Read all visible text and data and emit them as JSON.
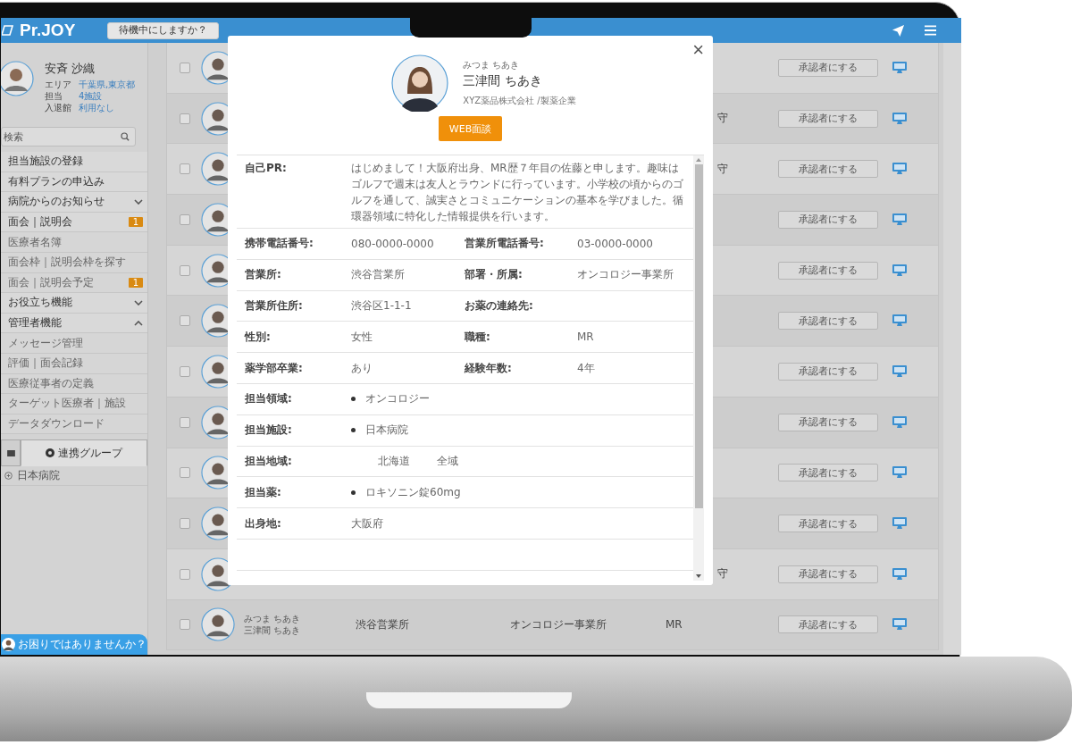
{
  "top_bar": {
    "logo": "Pr.JOY",
    "status_button": "待機中にしますか？"
  },
  "sidebar": {
    "profile": {
      "name": "安斉 沙織",
      "fields": [
        {
          "label": "エリア",
          "value": "千葉県,東京都"
        },
        {
          "label": "担当",
          "value": "4施設"
        },
        {
          "label": "入退館",
          "value": "利用なし"
        }
      ]
    },
    "search": {
      "placeholder": "検索"
    },
    "menu": [
      {
        "kind": "link",
        "label": "担当施設の登録"
      },
      {
        "kind": "link",
        "label": "有料プランの申込み"
      },
      {
        "kind": "group",
        "label": "病院からのお知らせ",
        "expanded": false
      },
      {
        "kind": "section",
        "label": "面会｜説明会",
        "badge": "1",
        "children": [
          {
            "label": "医療者名簿"
          },
          {
            "label": "面会枠｜説明会枠を探す"
          },
          {
            "label": "面会｜説明会予定",
            "badge": "1"
          }
        ]
      },
      {
        "kind": "group",
        "label": "お役立ち機能",
        "expanded": false
      },
      {
        "kind": "group",
        "label": "管理者機能",
        "expanded": true,
        "children": [
          {
            "label": "メッセージ管理"
          },
          {
            "label": "評価｜面会記録"
          },
          {
            "label": "医療従事者の定義"
          },
          {
            "label": "ターゲット医療者｜施設"
          },
          {
            "label": "データダウンロード"
          }
        ]
      }
    ],
    "tabs": [
      {
        "kind": "mail",
        "selected": false
      },
      {
        "kind": "group",
        "label": "連携グループ",
        "selected": true
      }
    ],
    "group_items": [
      "日本病院"
    ],
    "help_button": "お困りではありませんか？"
  },
  "rows": [
    {
      "checked": false,
      "button": "承認者にする"
    },
    {
      "checked": false,
      "partial_text": "守",
      "button": "承認者にする"
    },
    {
      "checked": false,
      "partial_text": "守",
      "button": "承認者にする"
    },
    {
      "checked": false,
      "button": "承認者にする"
    },
    {
      "checked": false,
      "button": "承認者にする"
    },
    {
      "checked": false,
      "button": "承認者にする"
    },
    {
      "checked": false,
      "button": "承認者にする"
    },
    {
      "checked": false,
      "button": "承認者にする"
    },
    {
      "checked": false,
      "button": "承認者にする"
    },
    {
      "checked": false,
      "button": "承認者にする"
    },
    {
      "checked": false,
      "partial_text": "守",
      "button": "承認者にする"
    },
    {
      "checked": false,
      "name_kana": "みつま ちあき",
      "name": "三津間 ちあき",
      "office": "渋谷営業所",
      "department": "オンコロジー事業所",
      "role": "MR",
      "button": "承認者にする"
    }
  ],
  "modal": {
    "close": "×",
    "kana": "みつま ちあき",
    "name": "三津間 ちあき",
    "company": "XYZ薬品株式会社 /製薬企業",
    "action_button": "WEB面談",
    "details": [
      {
        "kind": "text",
        "label": "自己PR:",
        "value": "はじめまして！大阪府出身、MR歴７年目の佐藤と申します。趣味はゴルフで週末は友人とラウンドに行っています。小学校の頃からのゴルフを通して、誠実さとコミュニケーションの基本を学びました。循環器領域に特化した情報提供を行います。"
      },
      {
        "kind": "pair",
        "label": "携帯電話番号:",
        "value": "080-0000-0000",
        "label2": "営業所電話番号:",
        "value2": "03-0000-0000"
      },
      {
        "kind": "pair",
        "label": "営業所:",
        "value": "渋谷営業所",
        "label2": "部署・所属:",
        "value2": "オンコロジー事業所"
      },
      {
        "kind": "pair",
        "label": "営業所住所:",
        "value": "渋谷区1-1-1",
        "label2": "お薬の連絡先:"
      },
      {
        "kind": "pair",
        "label": "性別:",
        "value": "女性",
        "label2": "職種:",
        "value2": "MR"
      },
      {
        "kind": "pair",
        "label": "薬学部卒業:",
        "value": "あり",
        "label2": "経験年数:",
        "value2": "4年"
      },
      {
        "kind": "list",
        "label": "担当領域:",
        "items": [
          "オンコロジー"
        ]
      },
      {
        "kind": "list",
        "label": "担当施設:",
        "items": [
          "日本病院"
        ]
      },
      {
        "kind": "multi",
        "label": "担当地域:",
        "values": [
          "北海道",
          "全域"
        ]
      },
      {
        "kind": "list",
        "label": "担当薬:",
        "items": [
          "ロキソニン錠60mg"
        ]
      },
      {
        "kind": "text",
        "label": "出身地:",
        "value": "大阪府"
      },
      {
        "kind": "blank"
      }
    ]
  }
}
